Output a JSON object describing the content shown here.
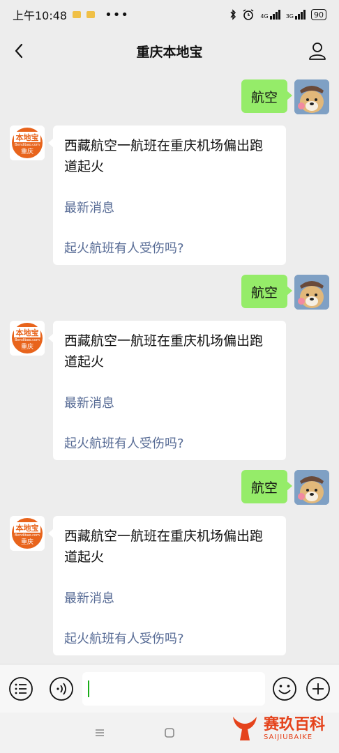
{
  "status_bar": {
    "time": "上午10:48",
    "more": "•••",
    "net1": "4G",
    "net2": "3G",
    "battery": "90"
  },
  "header": {
    "title": "重庆本地宝",
    "back_icon": "chevron-left-icon",
    "profile_icon": "person-icon"
  },
  "bot": {
    "logo_text": "本地宝",
    "logo_sub": "Bendibao.com",
    "logo_city": "重庆"
  },
  "messages": [
    {
      "sent": "航空",
      "reply_title": "西藏航空一航班在重庆机场偏出跑道起火",
      "link_1": "最新消息",
      "link_2": "起火航班有人受伤吗?"
    },
    {
      "sent": "航空",
      "reply_title": "西藏航空一航班在重庆机场偏出跑道起火",
      "link_1": "最新消息",
      "link_2": "起火航班有人受伤吗?"
    },
    {
      "sent": "航空",
      "reply_title": "西藏航空一航班在重庆机场偏出跑道起火",
      "link_1": "最新消息",
      "link_2": "起火航班有人受伤吗?"
    }
  ],
  "input_bar": {
    "menu_icon": "menu-list-icon",
    "voice_icon": "voice-icon",
    "emoji_icon": "emoji-icon",
    "plus_icon": "plus-icon",
    "input_value": ""
  },
  "watermark": {
    "main": "赛玖百科",
    "sub": "SAIJIUBAIKE"
  },
  "colors": {
    "sent_bubble": "#95ec69",
    "link": "#576b95",
    "background": "#ededed"
  }
}
